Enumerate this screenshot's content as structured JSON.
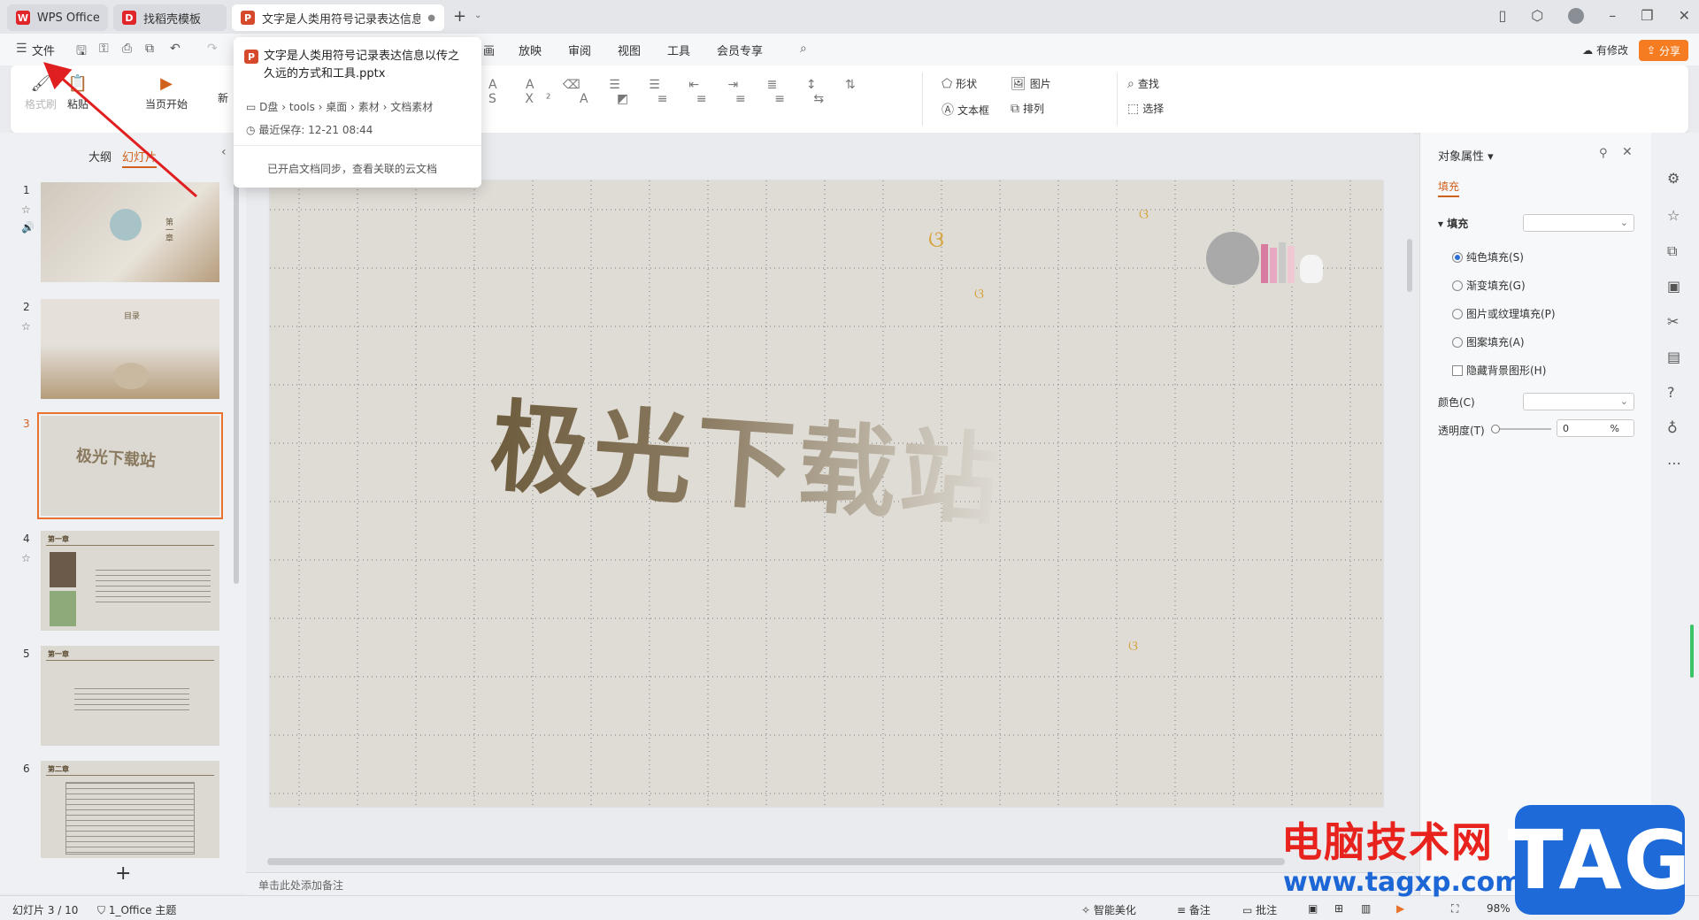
{
  "tabs": [
    {
      "label": "WPS Office",
      "logo": "W"
    },
    {
      "label": "找稻壳模板",
      "logo": "D"
    },
    {
      "label": "文字是人类用符号记录表达信息以",
      "logo": "P"
    }
  ],
  "menu": {
    "file": "文件",
    "items": [
      "画",
      "放映",
      "审阅",
      "视图",
      "工具",
      "会员专享"
    ],
    "revision": "有修改",
    "share": "分享"
  },
  "ribbon": {
    "format_painter": "格式刷",
    "paste": "粘贴",
    "from_current": "当页开始",
    "new": "新",
    "shape": "形状",
    "picture": "图片",
    "find": "查找",
    "textbox": "文本框",
    "arrange": "排列",
    "select": "选择"
  },
  "left_panel": {
    "tab_outline": "大纲",
    "tab_slides": "幻灯片",
    "slide_numbers": [
      "1",
      "2",
      "3",
      "4",
      "5",
      "6"
    ],
    "thumb1_text": "第一章",
    "thumb2_text": "目录",
    "thumb3_text": "极光下载站",
    "thumb4_header": "第一章",
    "thumb5_header": "第一章",
    "thumb6_header": "第二章"
  },
  "slide": {
    "title": "极光下载站"
  },
  "notes_placeholder": "单击此处添加备注",
  "properties": {
    "title": "对象属性",
    "tab_fill": "填充",
    "fill_label": "填充",
    "options": [
      "纯色填充(S)",
      "渐变填充(G)",
      "图片或纹理填充(P)",
      "图案填充(A)"
    ],
    "hide_bg": "隐藏背景图形(H)",
    "color_label": "颜色(C)",
    "transparency_label": "透明度(T)",
    "transparency_value": "0",
    "transparency_unit": "%"
  },
  "popup": {
    "title": "文字是人类用符号记录表达信息以传之久远的方式和工具.pptx",
    "path": [
      "D盘",
      "tools",
      "桌面",
      "素材",
      "文档素材"
    ],
    "last_saved": "最近保存: 12-21 08:44",
    "sync": "已开启文档同步，查看关联的云文档"
  },
  "statusbar": {
    "slide_info": "幻灯片 3 / 10",
    "theme": "1_Office 主题",
    "beautify": "智能美化",
    "notes": "备注",
    "comments": "批注",
    "zoom": "98%"
  },
  "watermark": {
    "title": "电脑技术网",
    "url": "www.tagxp.com",
    "tag": "TAG"
  },
  "colors": {
    "accent": "#d0611d",
    "share": "#f57c20"
  }
}
